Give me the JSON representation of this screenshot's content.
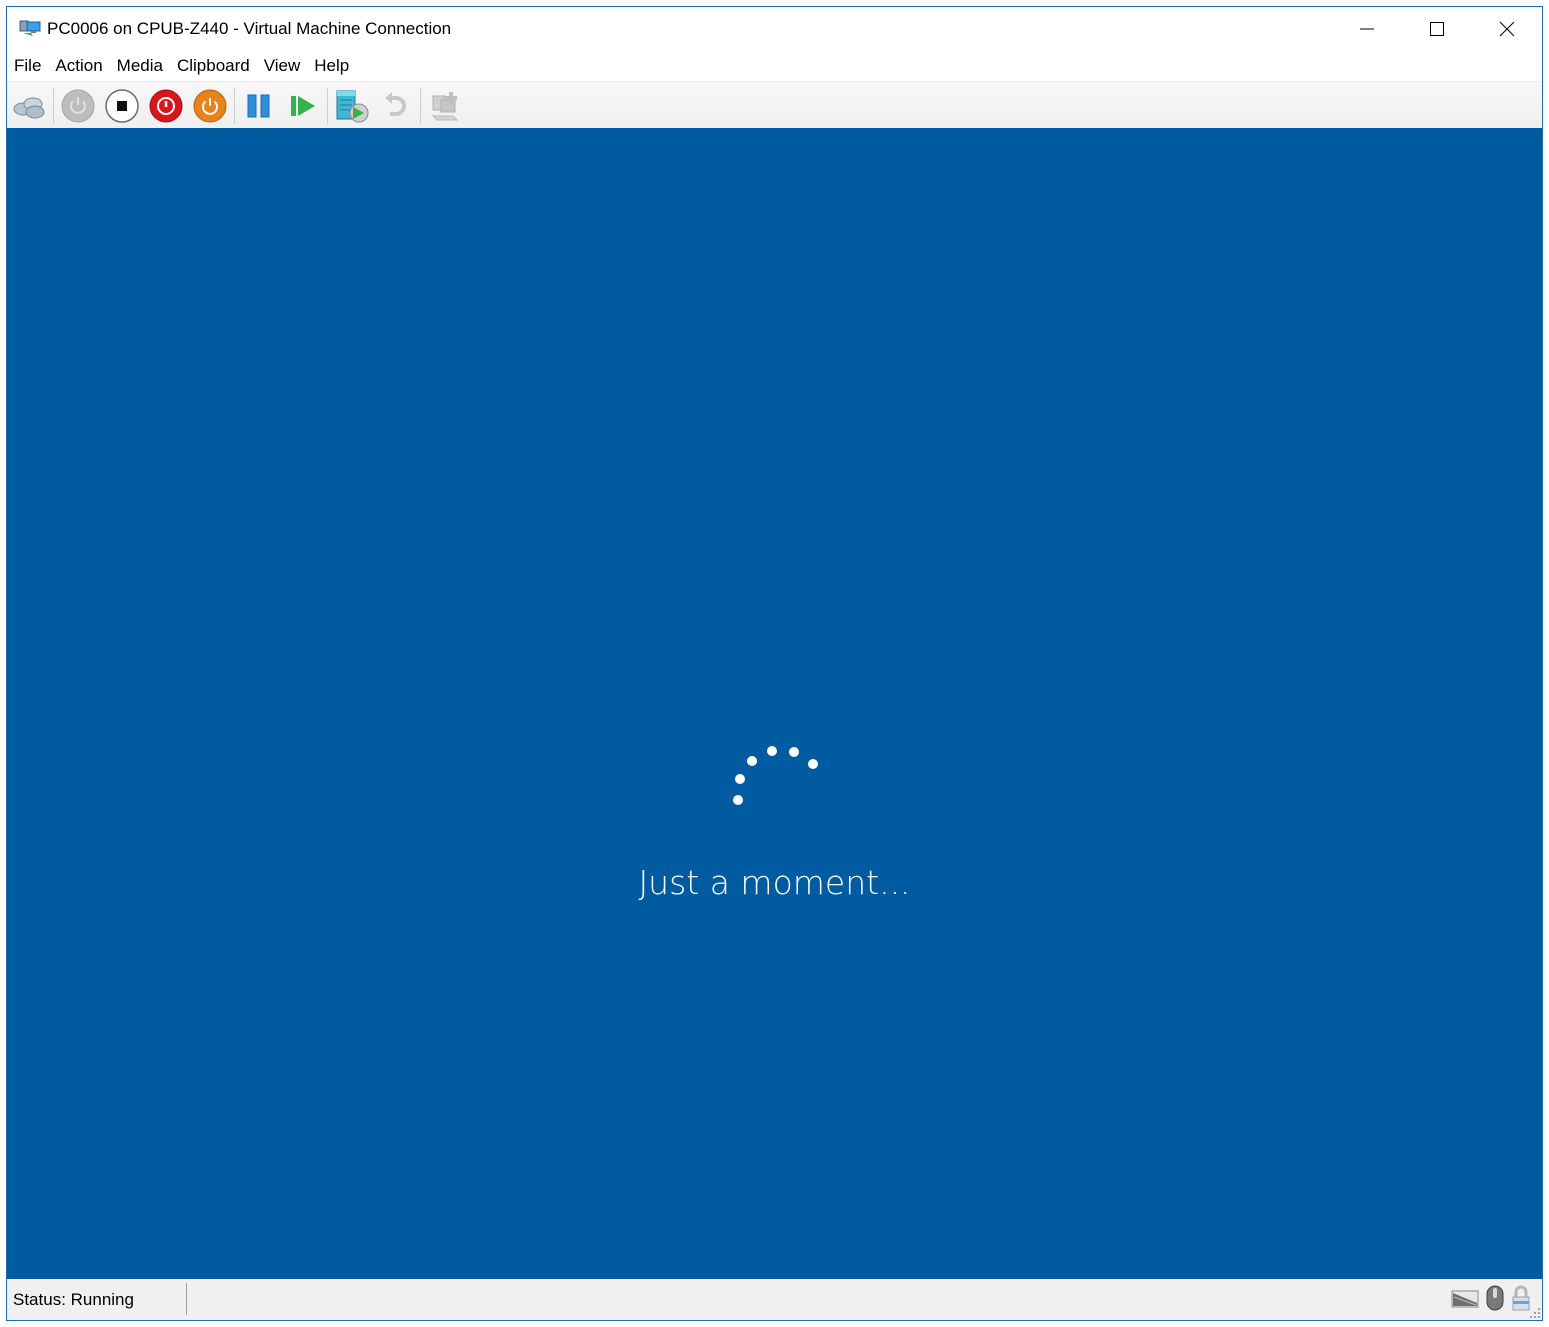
{
  "window": {
    "title": "PC0006 on CPUB-Z440 - Virtual Machine Connection",
    "app_icon": "vm-connection-icon",
    "controls": {
      "minimize": "minimize-icon",
      "maximize": "maximize-icon",
      "close": "close-icon"
    }
  },
  "menubar": {
    "items": [
      {
        "label": "File"
      },
      {
        "label": "Action"
      },
      {
        "label": "Media"
      },
      {
        "label": "Clipboard"
      },
      {
        "label": "View"
      },
      {
        "label": "Help"
      }
    ]
  },
  "toolbar": {
    "buttons": [
      {
        "name": "ctrl-alt-del",
        "icon": "keyboard-keys-icon",
        "enabled": true
      },
      {
        "name": "start",
        "icon": "power-icon",
        "enabled": false
      },
      {
        "name": "turn-off",
        "icon": "stop-icon",
        "enabled": true
      },
      {
        "name": "shut-down",
        "icon": "shutdown-icon",
        "enabled": true,
        "color": "#d8161c"
      },
      {
        "name": "save",
        "icon": "save-state-icon",
        "enabled": true,
        "color": "#e8831a"
      },
      {
        "name": "pause",
        "icon": "pause-icon",
        "enabled": true,
        "color": "#2f8ddb"
      },
      {
        "name": "reset",
        "icon": "reset-icon",
        "enabled": true,
        "color": "#33b44a"
      },
      {
        "name": "checkpoint",
        "icon": "checkpoint-icon",
        "enabled": true
      },
      {
        "name": "revert",
        "icon": "revert-icon",
        "enabled": false
      },
      {
        "name": "enhanced-session",
        "icon": "enhanced-session-icon",
        "enabled": false
      }
    ]
  },
  "screen": {
    "background": "#005ba1",
    "message": "Just a moment...",
    "spinner_icon": "loading-spinner-icon"
  },
  "statusbar": {
    "status": "Status: Running",
    "icons": [
      "keyboard-status-icon",
      "mouse-status-icon",
      "lock-status-icon"
    ]
  }
}
